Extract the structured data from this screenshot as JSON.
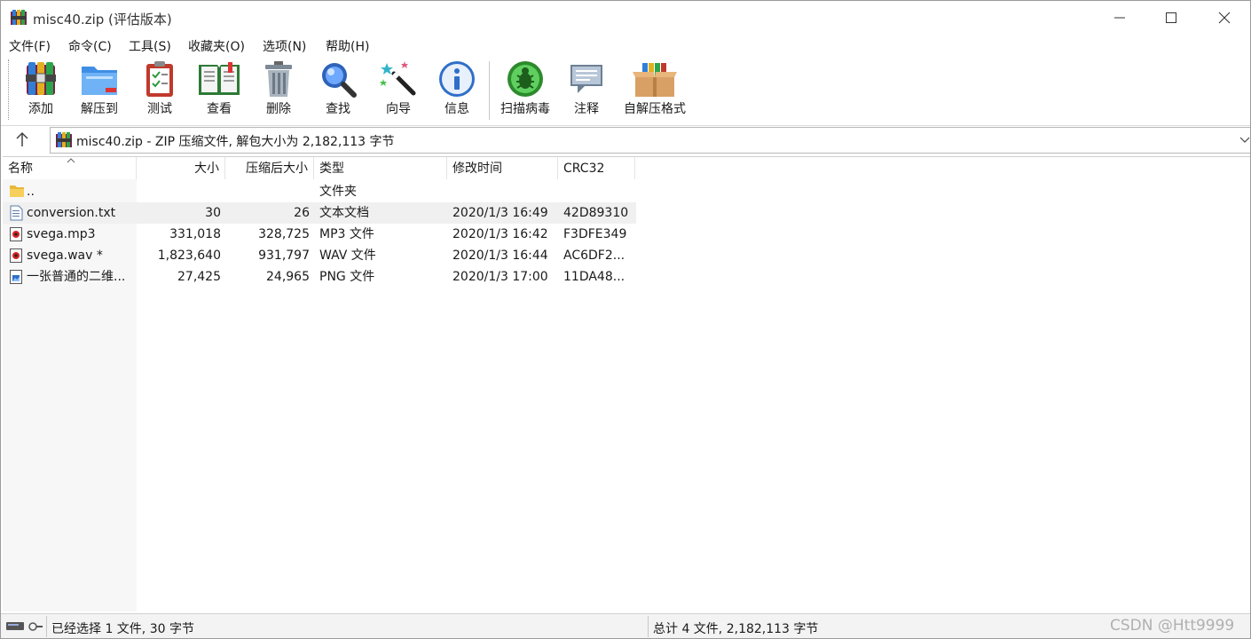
{
  "window": {
    "title": "misc40.zip (评估版本)"
  },
  "menu": [
    "文件(F)",
    "命令(C)",
    "工具(S)",
    "收藏夹(O)",
    "选项(N)",
    "帮助(H)"
  ],
  "toolbar": {
    "tools": [
      {
        "label": "添加",
        "icon": "add-archive-icon"
      },
      {
        "label": "解压到",
        "icon": "extract-folder-icon"
      },
      {
        "label": "测试",
        "icon": "test-clipboard-icon"
      },
      {
        "label": "查看",
        "icon": "view-book-icon"
      },
      {
        "label": "删除",
        "icon": "trash-icon"
      },
      {
        "label": "查找",
        "icon": "magnifier-icon"
      },
      {
        "label": "向导",
        "icon": "wizard-wand-icon"
      },
      {
        "label": "信息",
        "icon": "info-icon"
      },
      {
        "label": "扫描病毒",
        "icon": "virus-scan-icon"
      },
      {
        "label": "注释",
        "icon": "comment-icon"
      },
      {
        "label": "自解压格式",
        "icon": "sfx-box-icon"
      }
    ]
  },
  "address": {
    "path": "misc40.zip - ZIP 压缩文件, 解包大小为 2,182,113 字节"
  },
  "columns": {
    "name": "名称",
    "size": "大小",
    "packed": "压缩后大小",
    "type": "类型",
    "modified": "修改时间",
    "crc": "CRC32"
  },
  "rows": [
    {
      "name": "..",
      "size": "",
      "packed": "",
      "type": "文件夹",
      "modified": "",
      "crc": "",
      "icon": "folder-icon"
    },
    {
      "name": "conversion.txt",
      "size": "30",
      "packed": "26",
      "type": "文本文档",
      "modified": "2020/1/3 16:49",
      "crc": "42D89310",
      "icon": "text-file-icon"
    },
    {
      "name": "svega.mp3",
      "size": "331,018",
      "packed": "328,725",
      "type": "MP3 文件",
      "modified": "2020/1/3 16:42",
      "crc": "F3DFE349",
      "icon": "audio-file-icon"
    },
    {
      "name": "svega.wav *",
      "size": "1,823,640",
      "packed": "931,797",
      "type": "WAV 文件",
      "modified": "2020/1/3 16:44",
      "crc": "AC6DF2...",
      "icon": "audio-file-icon"
    },
    {
      "name": "一张普通的二维...",
      "size": "27,425",
      "packed": "24,965",
      "type": "PNG 文件",
      "modified": "2020/1/3 17:00",
      "crc": "11DA48...",
      "icon": "image-file-icon"
    }
  ],
  "selected_row": 1,
  "status": {
    "left": "已经选择 1 文件, 30 字节",
    "right": "总计 4 文件, 2,182,113 字节"
  },
  "watermark": "CSDN @Htt9999"
}
